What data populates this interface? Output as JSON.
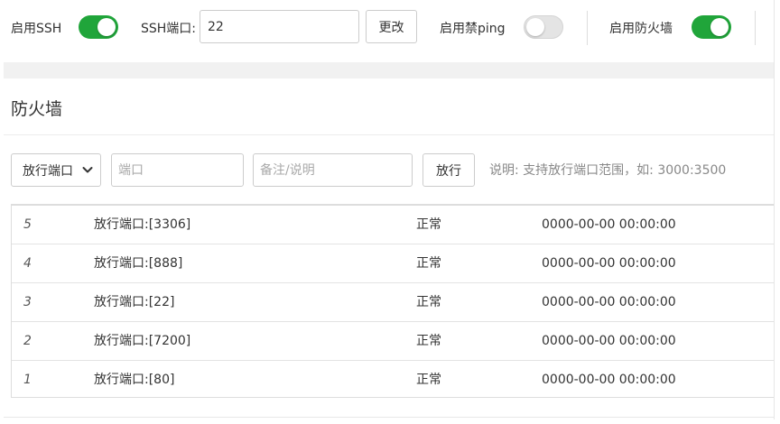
{
  "top_settings": {
    "ssh_label": "启用SSH",
    "ssh_enabled": true,
    "ssh_port_label": "SSH端口:",
    "ssh_port_value": "22",
    "change_button": "更改",
    "ping_label": "启用禁ping",
    "ping_enabled": false,
    "firewall_label": "启用防火墙",
    "firewall_enabled": true
  },
  "firewall": {
    "title": "防火墙",
    "select_value": "放行端口",
    "port_placeholder": "端口",
    "remark_placeholder": "备注/说明",
    "allow_button": "放行",
    "help_text": "说明: 支持放行端口范围，如: 3000:3500"
  },
  "rules": [
    {
      "id": "5",
      "name": "放行端口:[3306]",
      "status": "正常",
      "time": "0000-00-00 00:00:00"
    },
    {
      "id": "4",
      "name": "放行端口:[888]",
      "status": "正常",
      "time": "0000-00-00 00:00:00"
    },
    {
      "id": "3",
      "name": "放行端口:[22]",
      "status": "正常",
      "time": "0000-00-00 00:00:00"
    },
    {
      "id": "2",
      "name": "放行端口:[7200]",
      "status": "正常",
      "time": "0000-00-00 00:00:00"
    },
    {
      "id": "1",
      "name": "放行端口:[80]",
      "status": "正常",
      "time": "0000-00-00 00:00:00"
    }
  ],
  "colors": {
    "accent_green": "#20a53a",
    "toggle_off": "#e4e4e4"
  },
  "icons": {
    "select_chevron": "chevron-down-icon"
  }
}
